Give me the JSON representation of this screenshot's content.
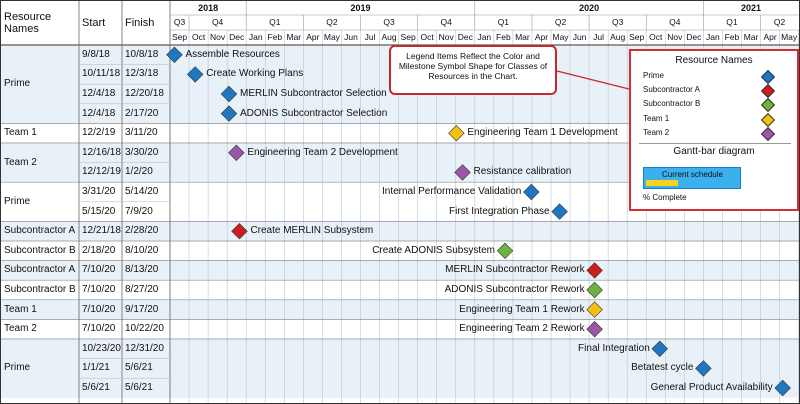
{
  "headers": {
    "resource": "Resource Names",
    "start": "Start",
    "finish": "Finish"
  },
  "timeline": {
    "years": [
      "2018",
      "2019",
      "2020",
      "2021"
    ],
    "quarters": [
      "Q3",
      "Q4",
      "Q1",
      "Q2",
      "Q3",
      "Q4",
      "Q1",
      "Q2",
      "Q3",
      "Q4",
      "Q1",
      "Q2"
    ],
    "months": [
      "Sep",
      "Oct",
      "Nov",
      "Dec",
      "Jan",
      "Feb",
      "Mar",
      "Apr",
      "May",
      "Jun",
      "Jul",
      "Aug",
      "Sep",
      "Oct",
      "Nov",
      "Dec",
      "Jan",
      "Feb",
      "Mar",
      "Apr",
      "May",
      "Jun",
      "Jul",
      "Aug",
      "Sep",
      "Oct",
      "Nov",
      "Dec",
      "Jan",
      "Feb",
      "Mar",
      "Apr",
      "May"
    ]
  },
  "colors": {
    "Prime": "#1f77c4",
    "Subcontractor A": "#c9201f",
    "Subcontractor B": "#6db33f",
    "Team 1": "#f5bf14",
    "Team 2": "#9b57a6",
    "row_alt": "#e9f1f8",
    "grid": "#b8c5d2",
    "legend_border": "#d42e33"
  },
  "chart_data": {
    "type": "gantt-milestone",
    "x_axis": {
      "start": "2018-09",
      "end": "2021-05",
      "unit": "month"
    },
    "groups": [
      {
        "resource": "Prime",
        "tasks": [
          {
            "start": "9/8/18",
            "finish": "10/8/18",
            "name": "Assemble Resources",
            "date": "2018-09-08"
          },
          {
            "start": "10/11/18",
            "finish": "12/3/18",
            "name": "Create Working Plans",
            "date": "2018-10-11"
          },
          {
            "start": "12/4/18",
            "finish": "12/20/18",
            "name": "MERLIN Subcontractor Selection",
            "date": "2018-12-04"
          },
          {
            "start": "12/4/18",
            "finish": "2/17/20",
            "name": "ADONIS Subcontractor Selection",
            "date": "2018-12-04"
          }
        ]
      },
      {
        "resource": "Team 1",
        "tasks": [
          {
            "start": "12/2/19",
            "finish": "3/11/20",
            "name": "Engineering Team 1 Development",
            "date": "2019-12-02"
          }
        ]
      },
      {
        "resource": "Team 2",
        "tasks": [
          {
            "start": "12/16/18",
            "finish": "3/30/20",
            "name": "Engineering Team 2 Development",
            "date": "2018-12-16"
          },
          {
            "start": "12/12/19",
            "finish": "1/2/20",
            "name": "Resistance calibration",
            "date": "2019-12-12"
          }
        ]
      },
      {
        "resource": "Prime",
        "tasks": [
          {
            "start": "3/31/20",
            "finish": "5/14/20",
            "name": "Internal Performance Validation",
            "date": "2020-03-31"
          },
          {
            "start": "5/15/20",
            "finish": "7/9/20",
            "name": "First Integration Phase",
            "date": "2020-05-15"
          }
        ]
      },
      {
        "resource": "Subcontractor A",
        "tasks": [
          {
            "start": "12/21/18",
            "finish": "2/28/20",
            "name": "Create MERLIN Subsystem",
            "date": "2018-12-21"
          }
        ]
      },
      {
        "resource": "Subcontractor B",
        "tasks": [
          {
            "start": "2/18/20",
            "finish": "8/10/20",
            "name": "Create ADONIS Subsystem",
            "date": "2020-02-18"
          }
        ]
      },
      {
        "resource": "Subcontractor A",
        "tasks": [
          {
            "start": "7/10/20",
            "finish": "8/13/20",
            "name": "MERLIN Subcontractor Rework",
            "date": "2020-07-10"
          }
        ]
      },
      {
        "resource": "Subcontractor B",
        "tasks": [
          {
            "start": "7/10/20",
            "finish": "8/27/20",
            "name": "ADONIS Subcontractor Rework",
            "date": "2020-07-10"
          }
        ]
      },
      {
        "resource": "Team 1",
        "tasks": [
          {
            "start": "7/10/20",
            "finish": "9/17/20",
            "name": "Engineering Team 1 Rework",
            "date": "2020-07-10"
          }
        ]
      },
      {
        "resource": "Team 2",
        "tasks": [
          {
            "start": "7/10/20",
            "finish": "10/22/20",
            "name": "Engineering Team 2 Rework",
            "date": "2020-07-10"
          }
        ]
      },
      {
        "resource": "Prime",
        "tasks": [
          {
            "start": "10/23/20",
            "finish": "12/31/20",
            "name": "Final Integration",
            "date": "2020-10-23"
          },
          {
            "start": "1/1/21",
            "finish": "5/6/21",
            "name": "Betatest cycle",
            "date": "2021-01-01"
          },
          {
            "start": "5/6/21",
            "finish": "5/6/21",
            "name": "General Product Availability",
            "date": "2021-05-06"
          }
        ]
      }
    ]
  },
  "callout": {
    "text": "Legend Items Reflect the Color and Milestone Symbol Shape for Classes of Resources in the Chart."
  },
  "legend": {
    "title": "Resource Names",
    "items": [
      {
        "label": "Prime",
        "color": "#1f77c4"
      },
      {
        "label": "Subcontractor A",
        "color": "#c9201f"
      },
      {
        "label": "Subcontractor B",
        "color": "#6db33f"
      },
      {
        "label": "Team 1",
        "color": "#f5bf14"
      },
      {
        "label": "Team 2",
        "color": "#9b57a6"
      }
    ],
    "gantt_title": "Gantt-bar diagram",
    "current_schedule": "Current schedule",
    "percent_complete": "% Complete"
  }
}
